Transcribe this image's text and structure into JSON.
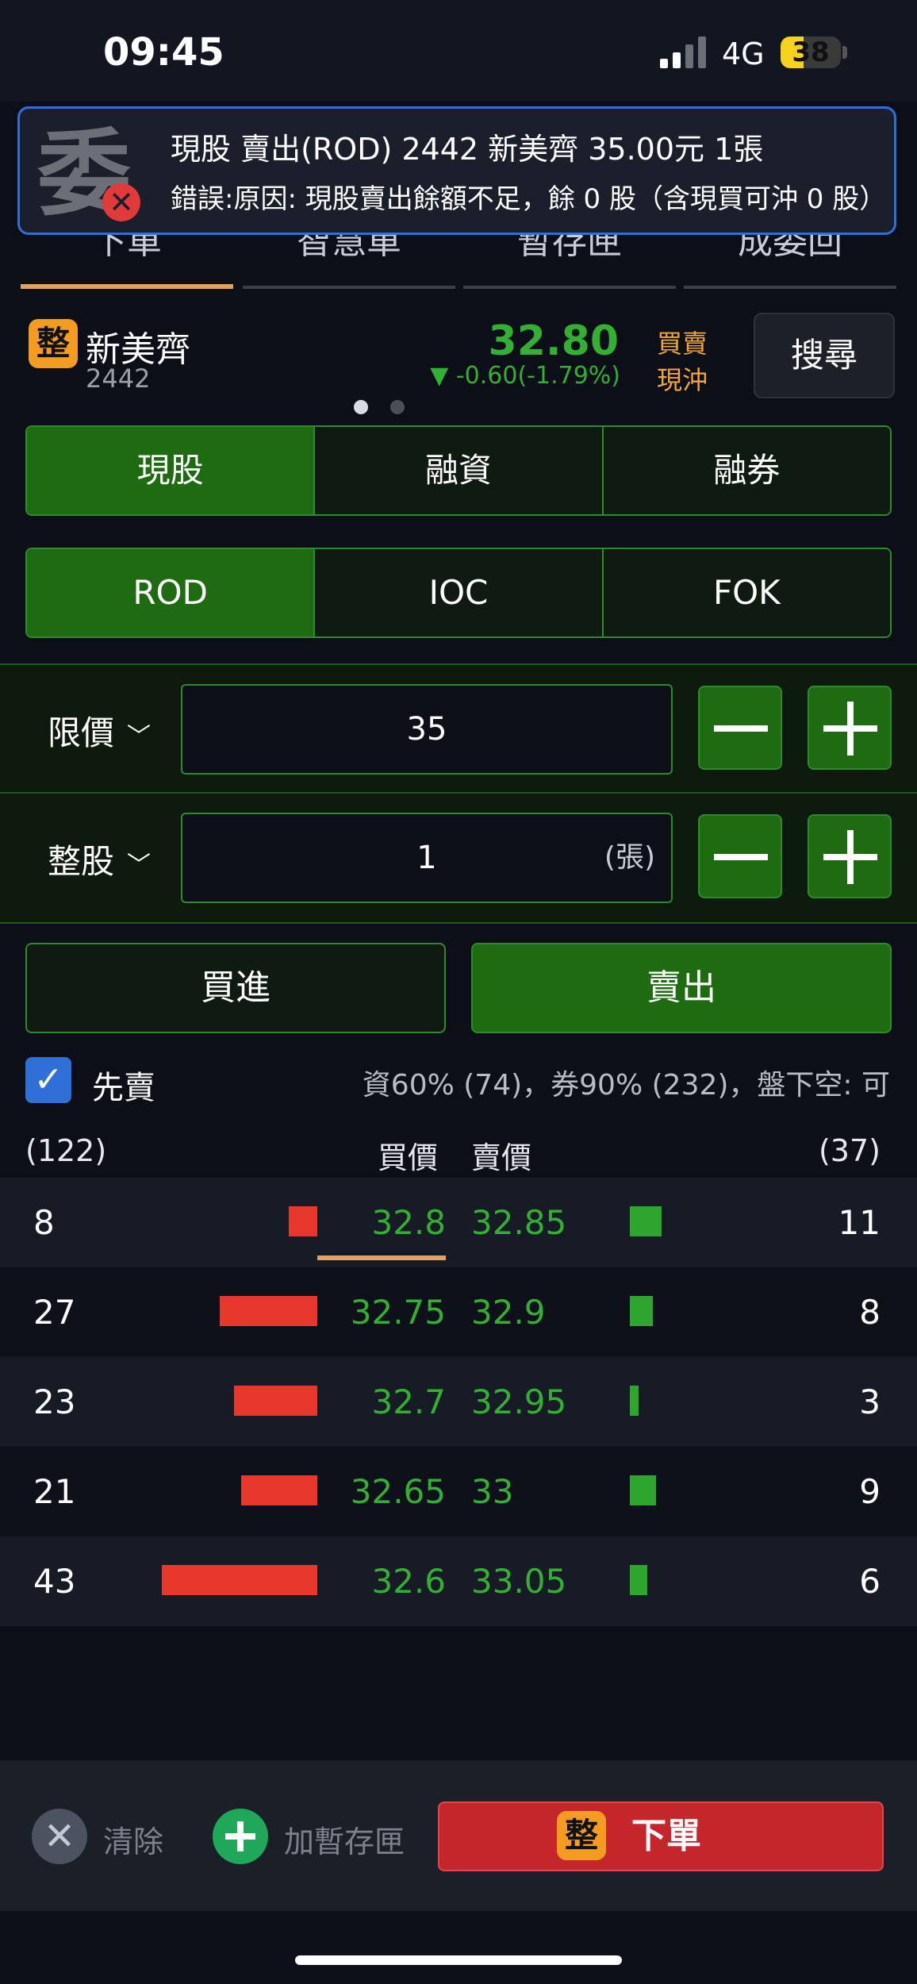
{
  "status_bar": {
    "time": "09:45",
    "network": "4G",
    "battery": "38",
    "battery_level": 0.38
  },
  "notification": {
    "icon_char": "委",
    "error_icon": "close-icon",
    "line1": "現股 賣出(ROD) 2442 新美齊 35.00元 1張",
    "line2": "錯誤:原因: 現股賣出餘額不足，餘 0 股（含現買可沖 0 股）"
  },
  "tabs": [
    {
      "label": "下單"
    },
    {
      "label": "智慧單"
    },
    {
      "label": "暫存匣"
    },
    {
      "label": "成委回"
    }
  ],
  "stock": {
    "badge": "整",
    "name": "新美齊",
    "code": "2442",
    "price": "32.80",
    "change": "▼ -0.60(-1.79%)",
    "trade_type_1": "買賣",
    "trade_type_2": "現沖",
    "search_label": "搜尋"
  },
  "account_types": [
    "現股",
    "融資",
    "融券"
  ],
  "order_conditions": [
    "ROD",
    "IOC",
    "FOK"
  ],
  "price_row": {
    "label": "限價",
    "value": "35"
  },
  "qty_row": {
    "label": "整股",
    "value": "1",
    "unit": "(張)"
  },
  "actions": {
    "buy": "買進",
    "sell": "賣出"
  },
  "sell_first": {
    "label": "先賣",
    "info": "資60% (74)，券90% (232)，盤下空: 可"
  },
  "order_book": {
    "bid_total": "(122)",
    "ask_total": "(37)",
    "bid_header": "買價",
    "ask_header": "賣價",
    "rows": [
      {
        "bid_qty": "8",
        "bid": "32.8",
        "ask": "32.85",
        "ask_qty": "11"
      },
      {
        "bid_qty": "27",
        "bid": "32.75",
        "ask": "32.9",
        "ask_qty": "8"
      },
      {
        "bid_qty": "23",
        "bid": "32.7",
        "ask": "32.95",
        "ask_qty": "3"
      },
      {
        "bid_qty": "21",
        "bid": "32.65",
        "ask": "33",
        "ask_qty": "9"
      },
      {
        "bid_qty": "43",
        "bid": "32.6",
        "ask": "33.05",
        "ask_qty": "6"
      }
    ]
  },
  "bottom_bar": {
    "clear": "清除",
    "add_draft": "加暫存匣",
    "order_badge": "整",
    "order": "下單"
  },
  "colors": {
    "up_down_green": "#33b033",
    "bid_bar": "#e8372d",
    "ask_bar": "#2ea52e",
    "accent": "#f39c1f",
    "order": "#c5262c"
  }
}
